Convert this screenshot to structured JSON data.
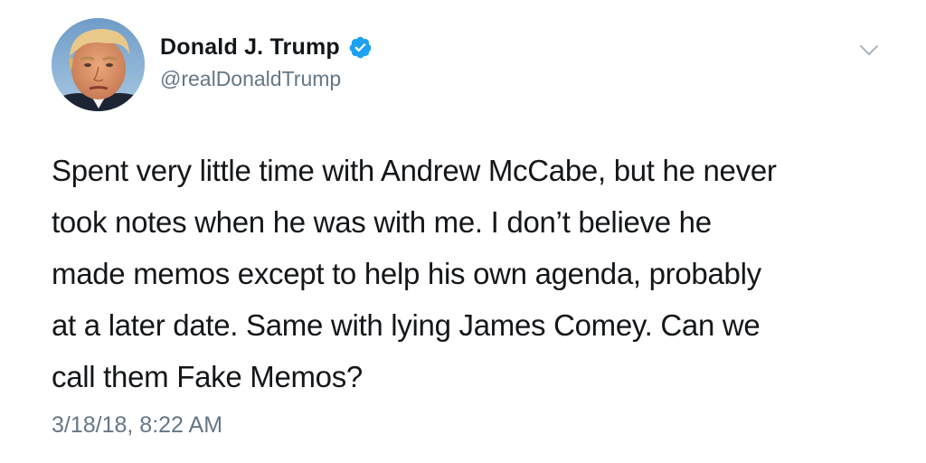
{
  "author": {
    "display_name": "Donald J. Trump",
    "handle": "@realDonaldTrump",
    "verified": true,
    "avatar_icon": "profile-photo",
    "verified_icon": "verified-badge-icon",
    "verified_color": "#1da1f2"
  },
  "menu": {
    "icon": "chevron-down-icon",
    "color": "#aab8c2"
  },
  "tweet": {
    "lines": [
      "Spent very little time with Andrew McCabe, but he never",
      "took notes when he was with me. I don’t believe he",
      "made memos except to help his own agenda, probably",
      "at a later date. Same with lying James Comey. Can we",
      "call them Fake Memos?"
    ],
    "timestamp": "3/18/18, 8:22 AM"
  },
  "colors": {
    "text_primary": "#14171a",
    "text_secondary": "#657786"
  }
}
